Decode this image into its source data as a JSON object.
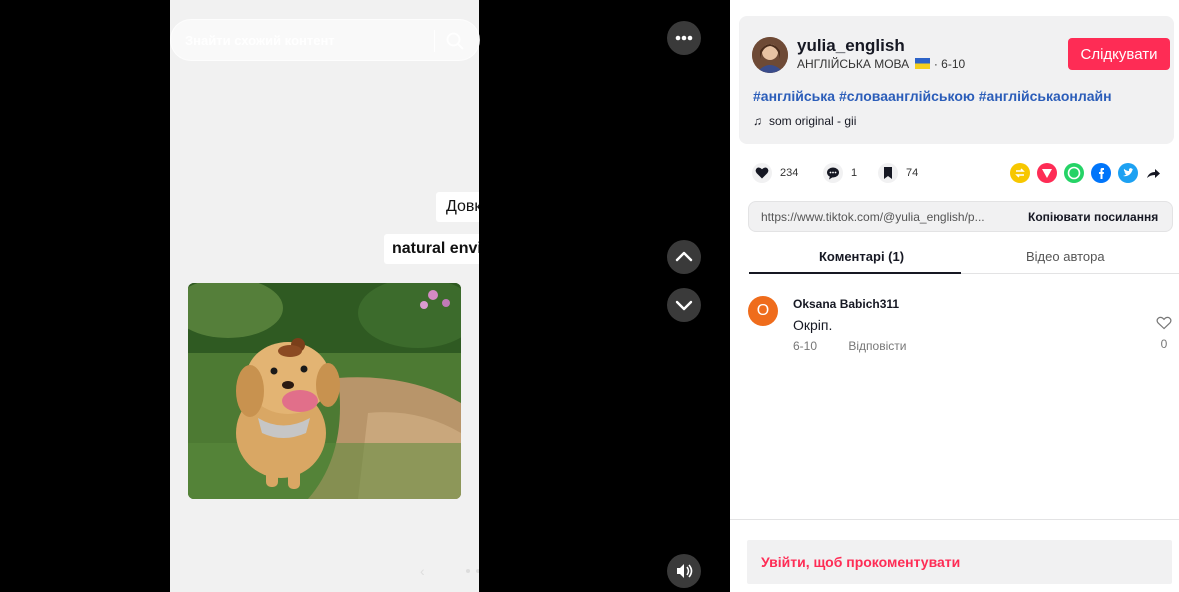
{
  "search": {
    "placeholder": "Знайти схожий контент"
  },
  "video": {
    "caption_line1": "Довкілля",
    "caption_line2": "natural environment"
  },
  "author": {
    "username": "yulia_english",
    "subtitle": "АНГЛІЙСЬКА МОВА",
    "date": "6-10",
    "follow_label": "Слідкувати"
  },
  "post": {
    "hashtags": "#англійська #словаанглійською #англійськаонлайн",
    "music": "som original - gii"
  },
  "stats": {
    "likes": "234",
    "comments": "1",
    "saves": "74"
  },
  "share": {
    "icons": [
      "repost-icon",
      "send-icon",
      "whatsapp-icon",
      "facebook-icon",
      "twitter-icon",
      "share-arrow-icon"
    ],
    "colors": {
      "repost": "#f7c700",
      "send": "#fe2c55",
      "whatsapp": "#25d366",
      "facebook": "#0075fa",
      "twitter": "#1da1f2"
    }
  },
  "link": {
    "url": "https://www.tiktok.com/@yulia_english/p...",
    "copy_label": "Копіювати посилання"
  },
  "tabs": [
    {
      "label": "Коментарі (1)",
      "active": true
    },
    {
      "label": "Відео автора",
      "active": false
    }
  ],
  "comments": [
    {
      "initial": "O",
      "author": "Oksana Babich311",
      "text": "Окріп.",
      "date": "6-10",
      "reply_label": "Відповісти",
      "likes": "0"
    }
  ],
  "login_prompt": "Увійти, щоб прокоментувати",
  "colors": {
    "accent": "#fe2c55",
    "hashtag": "#2b5db9",
    "player_bg": "#000000"
  }
}
